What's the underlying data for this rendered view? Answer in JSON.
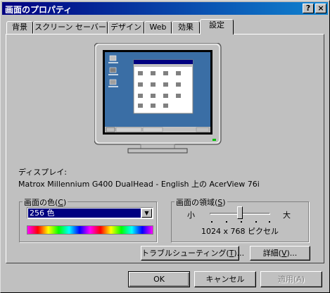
{
  "window": {
    "title": "画面のプロパティ",
    "help_button": "?",
    "close_button": "×"
  },
  "tabs": [
    "背景",
    "スクリーン セーバー",
    "デザイン",
    "Web",
    "効果",
    "設定"
  ],
  "active_tab": "設定",
  "display": {
    "label": "ディスプレイ:",
    "value": "Matrox Millennium G400 DualHead - English 上の AcerView 76i"
  },
  "colors": {
    "group_label": "画面の色(",
    "group_key": "C",
    "group_close": ")",
    "selected": "256 色"
  },
  "resolution": {
    "group_label": "画面の領域(",
    "group_key": "S",
    "group_close": ")",
    "less_label": "小",
    "more_label": "大",
    "value_text": "1024 x 768 ピクセル",
    "slider_level": 0.5
  },
  "buttons": {
    "troubleshoot": "トラブルシューティング(",
    "troubleshoot_key": "T",
    "troubleshoot_close": ")...",
    "advanced": "詳細(",
    "advanced_key": "V",
    "advanced_close": ")...",
    "ok": "OK",
    "cancel": "キャンセル",
    "apply": "適用(A)"
  },
  "preview_colors": {
    "desktop": "#3a6ea5",
    "bezel": "#c0c0c0",
    "screen_frame": "#000000"
  }
}
